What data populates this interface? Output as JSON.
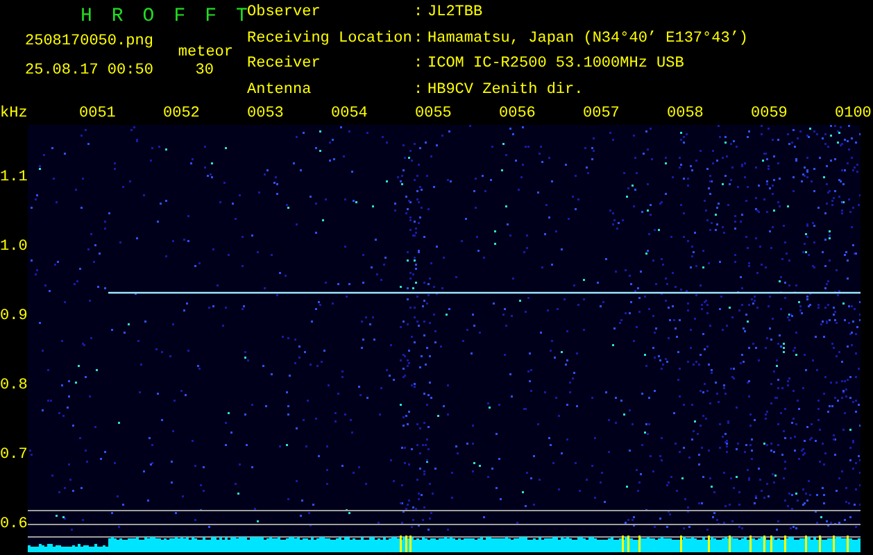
{
  "header": {
    "app_title": "HROFFT",
    "file_name": "2508170050.png",
    "timestamp": "25.08.17 00:50",
    "mode_label": "meteor",
    "mode_value": "30",
    "info_separator": ":",
    "info": [
      {
        "label": "Observer",
        "value": "JL2TBB"
      },
      {
        "label": "Receiving Location",
        "value": "Hamamatsu, Japan (N34°40’ E137°43’)"
      },
      {
        "label": "Receiver",
        "value": "ICOM IC-R2500 53.1000MHz USB"
      },
      {
        "label": "Antenna",
        "value": "HB9CV Zenith dir."
      }
    ]
  },
  "axis_unit": "kHz",
  "time_labels": [
    "0051",
    "0052",
    "0053",
    "0054",
    "0055",
    "0056",
    "0057",
    "0058",
    "0059",
    "0100"
  ],
  "freq_labels": [
    "1.1",
    "1.0",
    "0.9",
    "0.8",
    "0.7",
    "0.6"
  ]
}
